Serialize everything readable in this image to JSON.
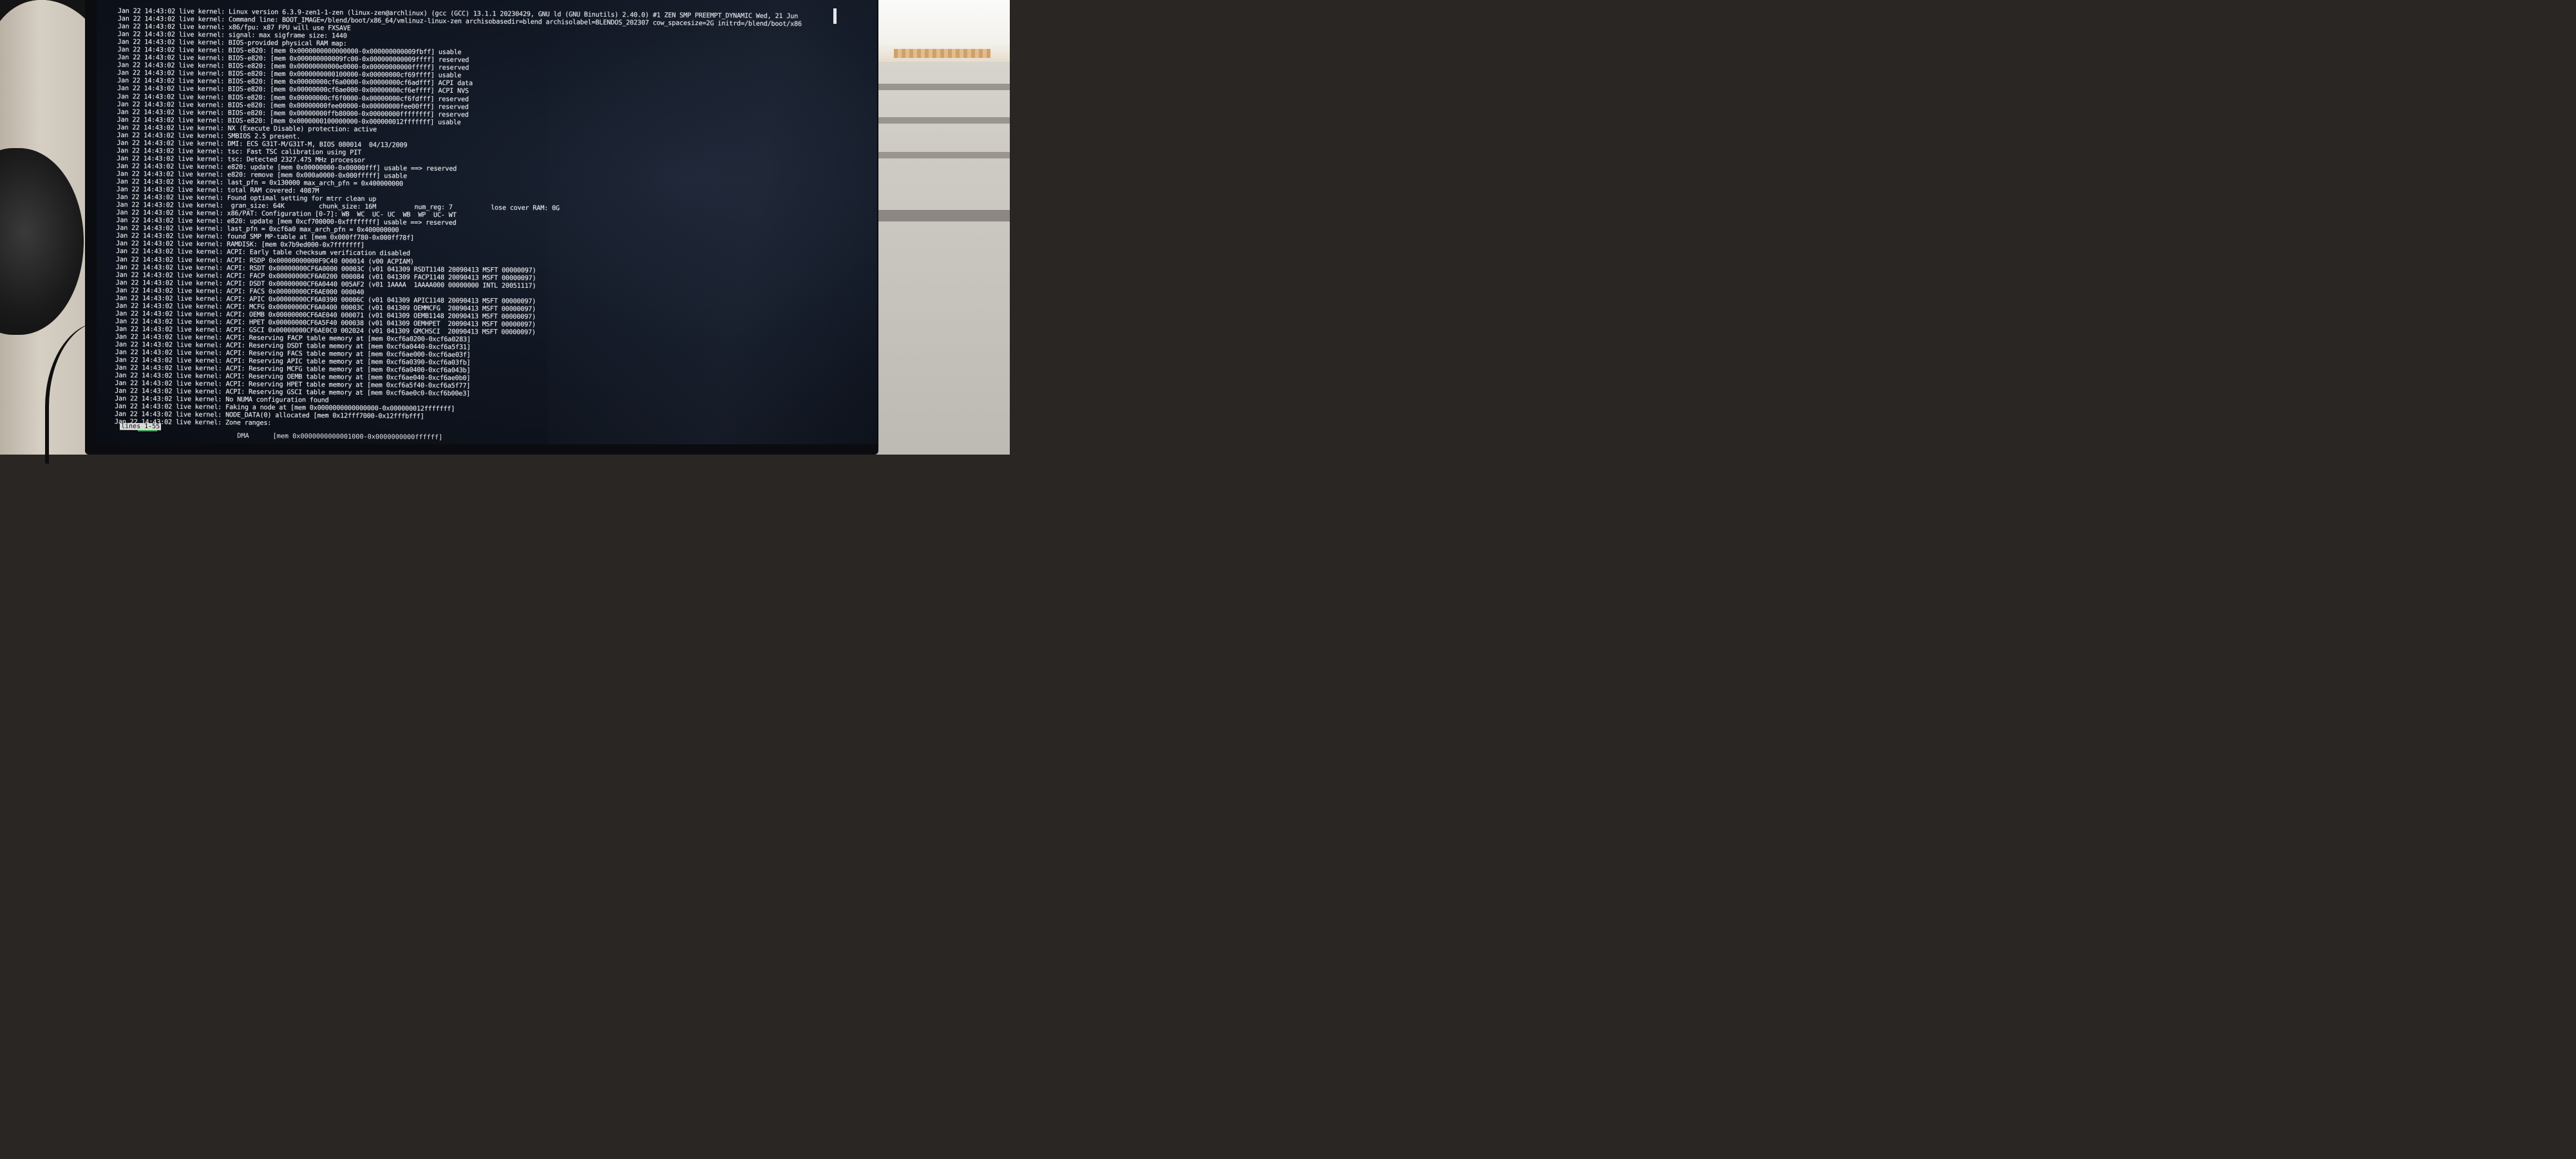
{
  "terminal": {
    "lines": [
      "Jan 22 14:43:02 live kernel: Linux version 6.3.9-zen1-1-zen (linux-zen@archlinux) (gcc (GCC) 13.1.1 20230429, GNU ld (GNU Binutils) 2.40.0) #1 ZEN SMP PREEMPT_DYNAMIC Wed, 21 Jun",
      "Jan 22 14:43:02 live kernel: Command line: BOOT_IMAGE=/blend/boot/x86_64/vmlinuz-linux-zen archisobasedir=blend archisolabel=BLENDOS_202307 cow_spacesize=2G initrd=/blend/boot/x86",
      "Jan 22 14:43:02 live kernel: x86/fpu: x87 FPU will use FXSAVE",
      "Jan 22 14:43:02 live kernel: signal: max sigframe size: 1440",
      "Jan 22 14:43:02 live kernel: BIOS-provided physical RAM map:",
      "Jan 22 14:43:02 live kernel: BIOS-e820: [mem 0x0000000000000000-0x000000000009fbff] usable",
      "Jan 22 14:43:02 live kernel: BIOS-e820: [mem 0x000000000009fc00-0x000000000009ffff] reserved",
      "Jan 22 14:43:02 live kernel: BIOS-e820: [mem 0x00000000000e0000-0x00000000000fffff] reserved",
      "Jan 22 14:43:02 live kernel: BIOS-e820: [mem 0x0000000000100000-0x00000000cf69ffff] usable",
      "Jan 22 14:43:02 live kernel: BIOS-e820: [mem 0x00000000cf6a0000-0x00000000cf6adfff] ACPI data",
      "Jan 22 14:43:02 live kernel: BIOS-e820: [mem 0x00000000cf6ae000-0x00000000cf6effff] ACPI NVS",
      "Jan 22 14:43:02 live kernel: BIOS-e820: [mem 0x00000000cf6f0000-0x00000000cf6fdfff] reserved",
      "Jan 22 14:43:02 live kernel: BIOS-e820: [mem 0x00000000fee00000-0x00000000fee00fff] reserved",
      "Jan 22 14:43:02 live kernel: BIOS-e820: [mem 0x00000000ffb80000-0x00000000ffffffff] reserved",
      "Jan 22 14:43:02 live kernel: BIOS-e820: [mem 0x0000000100000000-0x000000012fffffff] usable",
      "Jan 22 14:43:02 live kernel: NX (Execute Disable) protection: active",
      "Jan 22 14:43:02 live kernel: SMBIOS 2.5 present.",
      "Jan 22 14:43:02 live kernel: DMI: ECS G31T-M/G31T-M, BIOS 080014  04/13/2009",
      "Jan 22 14:43:02 live kernel: tsc: Fast TSC calibration using PIT",
      "Jan 22 14:43:02 live kernel: tsc: Detected 2327.475 MHz processor",
      "Jan 22 14:43:02 live kernel: e820: update [mem 0x00000000-0x00000fff] usable ==> reserved",
      "Jan 22 14:43:02 live kernel: e820: remove [mem 0x000a0000-0x000fffff] usable",
      "Jan 22 14:43:02 live kernel: last_pfn = 0x130000 max_arch_pfn = 0x400000000",
      "Jan 22 14:43:02 live kernel: total RAM covered: 4087M",
      "Jan 22 14:43:02 live kernel: Found optimal setting for mtrr clean up",
      "Jan 22 14:43:02 live kernel:  gran_size: 64K         chunk_size: 16M          num_reg: 7          lose cover RAM: 0G",
      "Jan 22 14:43:02 live kernel: x86/PAT: Configuration [0-7]: WB  WC  UC- UC  WB  WP  UC- WT",
      "Jan 22 14:43:02 live kernel: e820: update [mem 0xcf700000-0xffffffff] usable ==> reserved",
      "Jan 22 14:43:02 live kernel: last_pfn = 0xcf6a0 max_arch_pfn = 0x400000000",
      "Jan 22 14:43:02 live kernel: found SMP MP-table at [mem 0x000ff780-0x000ff78f]",
      "Jan 22 14:43:02 live kernel: RAMDISK: [mem 0x7b9ed000-0x7fffffff]",
      "Jan 22 14:43:02 live kernel: ACPI: Early table checksum verification disabled",
      "Jan 22 14:43:02 live kernel: ACPI: RSDP 0x00000000000F9C40 000014 (v00 ACPIAM)",
      "Jan 22 14:43:02 live kernel: ACPI: RSDT 0x00000000CF6A0000 00003C (v01 041309 RSDT1148 20090413 MSFT 00000097)",
      "Jan 22 14:43:02 live kernel: ACPI: FACP 0x00000000CF6A0200 000084 (v01 041309 FACP1148 20090413 MSFT 00000097)",
      "Jan 22 14:43:02 live kernel: ACPI: DSDT 0x00000000CF6A0440 005AF2 (v01 1AAAA  1AAAA000 00000000 INTL 20051117)",
      "Jan 22 14:43:02 live kernel: ACPI: FACS 0x00000000CF6AE000 000040",
      "Jan 22 14:43:02 live kernel: ACPI: APIC 0x00000000CF6A0390 00006C (v01 041309 APIC1148 20090413 MSFT 00000097)",
      "Jan 22 14:43:02 live kernel: ACPI: MCFG 0x00000000CF6A0400 00003C (v01 041309 OEMMCFG  20090413 MSFT 00000097)",
      "Jan 22 14:43:02 live kernel: ACPI: OEMB 0x00000000CF6AE040 000071 (v01 041309 OEMB1148 20090413 MSFT 00000097)",
      "Jan 22 14:43:02 live kernel: ACPI: HPET 0x00000000CF6A5F40 000038 (v01 041309 OEMHPET  20090413 MSFT 00000097)",
      "Jan 22 14:43:02 live kernel: ACPI: GSCI 0x00000000CF6AE0C0 002024 (v01 041309 GMCHSCI  20090413 MSFT 00000097)",
      "Jan 22 14:43:02 live kernel: ACPI: Reserving FACP table memory at [mem 0xcf6a0200-0xcf6a0283]",
      "Jan 22 14:43:02 live kernel: ACPI: Reserving DSDT table memory at [mem 0xcf6a0440-0xcf6a5f31]",
      "Jan 22 14:43:02 live kernel: ACPI: Reserving FACS table memory at [mem 0xcf6ae000-0xcf6ae03f]",
      "Jan 22 14:43:02 live kernel: ACPI: Reserving APIC table memory at [mem 0xcf6a0390-0xcf6a03fb]",
      "Jan 22 14:43:02 live kernel: ACPI: Reserving MCFG table memory at [mem 0xcf6a0400-0xcf6a043b]",
      "Jan 22 14:43:02 live kernel: ACPI: Reserving OEMB table memory at [mem 0xcf6ae040-0xcf6ae0b0]",
      "Jan 22 14:43:02 live kernel: ACPI: Reserving HPET table memory at [mem 0xcf6a5f40-0xcf6a5f77]",
      "Jan 22 14:43:02 live kernel: ACPI: Reserving GSCI table memory at [mem 0xcf6ae0c0-0xcf6b00e3]",
      "Jan 22 14:43:02 live kernel: No NUMA configuration found",
      "Jan 22 14:43:02 live kernel: Faking a node at [mem 0x0000000000000000-0x000000012fffffff]",
      "Jan 22 14:43:02 live kernel: NODE_DATA(0) allocated [mem 0x12fff7000-0x12fffbfff]",
      "Jan 22 14:43:02 live kernel: Zone ranges:"
    ],
    "dma_line": "  DMA      [mem 0x0000000000001000-0x0000000000ffffff]",
    "status": "lines 1-55"
  },
  "colors": {
    "terminal_text": "#e6e7ea",
    "screen_bg": "#111723",
    "status_underline": "#2fa64a"
  }
}
